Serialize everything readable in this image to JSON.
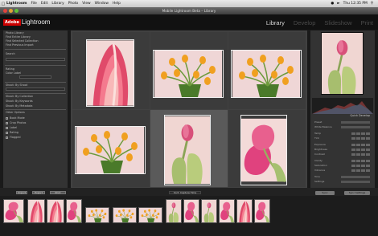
{
  "menubar": {
    "apple": "",
    "app_name": "Lightroom",
    "menus": [
      "File",
      "Edit",
      "Library",
      "Photo",
      "View",
      "Window",
      "Help"
    ],
    "clock": "Thu 12:35 PM"
  },
  "window": {
    "title": "Mobile Lightroom Beta – Library"
  },
  "identity_plate": {
    "adobe": "Adobe",
    "product": "Lightroom"
  },
  "modules": [
    {
      "label": "Library",
      "active": true
    },
    {
      "label": "Develop",
      "active": false
    },
    {
      "label": "Slideshow",
      "active": false
    },
    {
      "label": "Print",
      "active": false
    }
  ],
  "left_panel": {
    "rows": [
      "Photo Library",
      "Find Entire Library",
      "Find Selected Collection",
      "Find Previous Import",
      "Search",
      "Rating",
      "Color Label",
      "Find Master Photos",
      "Shoot: By Shoot",
      "Keywords",
      "Shoot: By Collection",
      "Shoot: By Keywords",
      "Shoot: By Metadata",
      "Other Options",
      "Book Mode",
      "Crop Photos",
      "Label",
      "Rating",
      "Flagged"
    ]
  },
  "right_panel": {
    "quick_develop": "Quick Develop",
    "rows": [
      "Preset",
      "White Balance",
      "Temp",
      "Tint",
      "Exposure",
      "Brightness",
      "Contrast",
      "Clarity",
      "Saturation",
      "Vibrance",
      "Tone",
      "Settings"
    ]
  },
  "toolbar": {
    "buttons": [
      "Import",
      "Export",
      "Print"
    ],
    "sort_label": "Sort: Capture Time",
    "sync_label": "Sync",
    "settings_label": "Sync Settings"
  },
  "colors": {
    "panel": "#333333",
    "grid": "#414141",
    "active_module": "#d8d8d8",
    "adobe_red": "#cc0000"
  },
  "photos": [
    "pink-tulip-closeup",
    "yellow-tulips-vase",
    "yellow-tulips-vase",
    "yellow-tulips-vase",
    "pink-tulip-stem",
    "pink-tulip-closeup"
  ]
}
